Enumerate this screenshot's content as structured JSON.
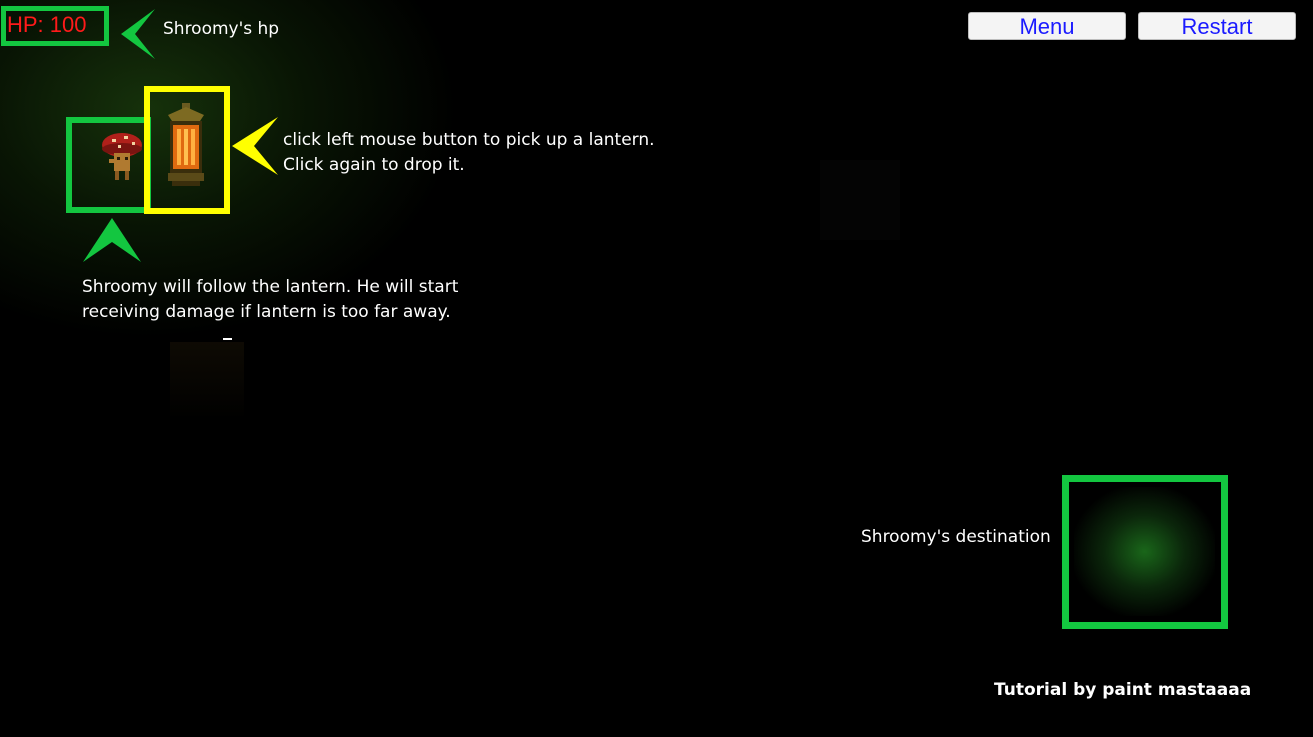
{
  "hud": {
    "hp_label": "HP: 100",
    "hp_color": "#ff1a1a"
  },
  "buttons": {
    "menu": "Menu",
    "restart": "Restart"
  },
  "annotations": {
    "hp_note": "Shroomy's hp",
    "lantern_line1": "click left mouse button to pick up a lantern.",
    "lantern_line2": "Click again to drop it.",
    "shroomy_line1": "Shroomy will follow the lantern. He will start",
    "shroomy_line2": "receiving damage if lantern is too far away.",
    "destination": "Shroomy's destination"
  },
  "credit": "Tutorial by paint mastaaaa",
  "colors": {
    "highlight_green": "#13c640",
    "highlight_yellow": "#ffff00",
    "button_text": "#1a1aff"
  },
  "sprites": {
    "player": "mushroom-character-icon",
    "lantern": "lantern-icon",
    "destination": "green-glow-destination"
  }
}
